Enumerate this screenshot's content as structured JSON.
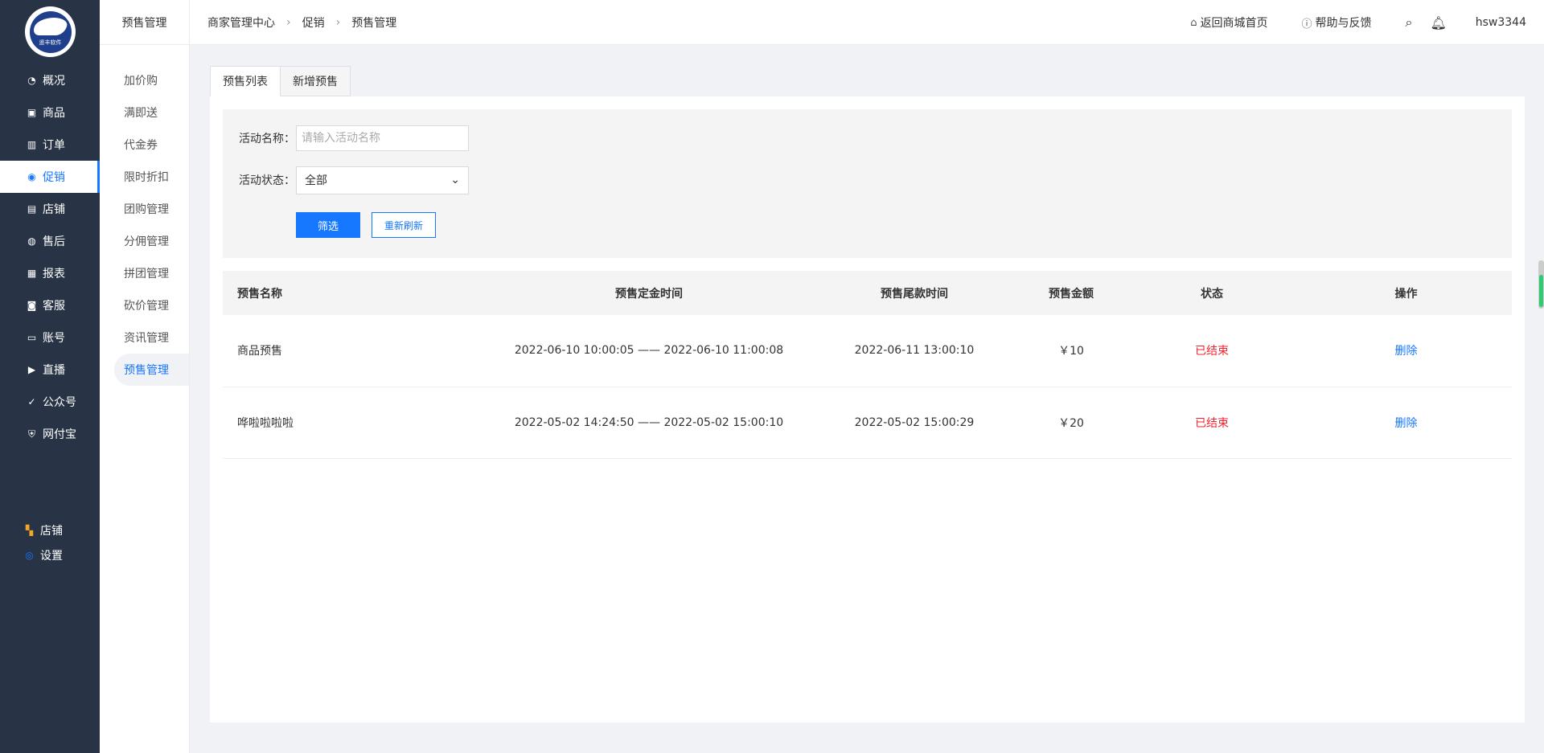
{
  "brand": {
    "logo_text": "遥丰软件"
  },
  "nav": {
    "items": [
      {
        "label": "概况",
        "icon": "dashboard-icon"
      },
      {
        "label": "商品",
        "icon": "goods-icon"
      },
      {
        "label": "订单",
        "icon": "chart-icon"
      },
      {
        "label": "促销",
        "icon": "promotion-icon",
        "active": true
      },
      {
        "label": "店铺",
        "icon": "store-icon"
      },
      {
        "label": "售后",
        "icon": "after-sales-icon"
      },
      {
        "label": "报表",
        "icon": "report-icon"
      },
      {
        "label": "客服",
        "icon": "service-icon"
      },
      {
        "label": "账号",
        "icon": "account-icon"
      },
      {
        "label": "直播",
        "icon": "live-icon"
      },
      {
        "label": "公众号",
        "icon": "wechat-icon"
      },
      {
        "label": "网付宝",
        "icon": "shield-icon"
      }
    ],
    "bottom": [
      {
        "label": "店铺",
        "icon": "grid-icon"
      },
      {
        "label": "设置",
        "icon": "settings-icon"
      }
    ]
  },
  "submenu": {
    "title": "预售管理",
    "items": [
      "加价购",
      "满即送",
      "代金券",
      "限时折扣",
      "团购管理",
      "分佣管理",
      "拼团管理",
      "砍价管理",
      "资讯管理",
      "预售管理"
    ]
  },
  "header": {
    "breadcrumb": [
      "商家管理中心",
      "促销",
      "预售管理"
    ],
    "home_link": "返回商城首页",
    "help_link": "帮助与反馈",
    "username": "hsw3344"
  },
  "tabs": [
    "预售列表",
    "新增预售"
  ],
  "filter": {
    "name_label": "活动名称：",
    "name_placeholder": "请输入活动名称",
    "name_value": "",
    "status_label": "活动状态：",
    "status_value": "全部",
    "filter_button": "筛选",
    "reset_button": "重新刷新"
  },
  "table": {
    "headers": [
      "预售名称",
      "预售定金时间",
      "预售尾款时间",
      "预售金额",
      "状态",
      "操作"
    ],
    "rows": [
      {
        "name": "商品预售",
        "deposit_time": "2022-06-10 10:00:05 —— 2022-06-10 11:00:08",
        "final_time": "2022-06-11 13:00:10",
        "amount": "￥10",
        "status": "已结束",
        "action": "删除"
      },
      {
        "name": "哗啦啦啦啦",
        "deposit_time": "2022-05-02 14:24:50 —— 2022-05-02 15:00:10",
        "final_time": "2022-05-02 15:00:29",
        "amount": "￥20",
        "status": "已结束",
        "action": "删除"
      }
    ]
  }
}
